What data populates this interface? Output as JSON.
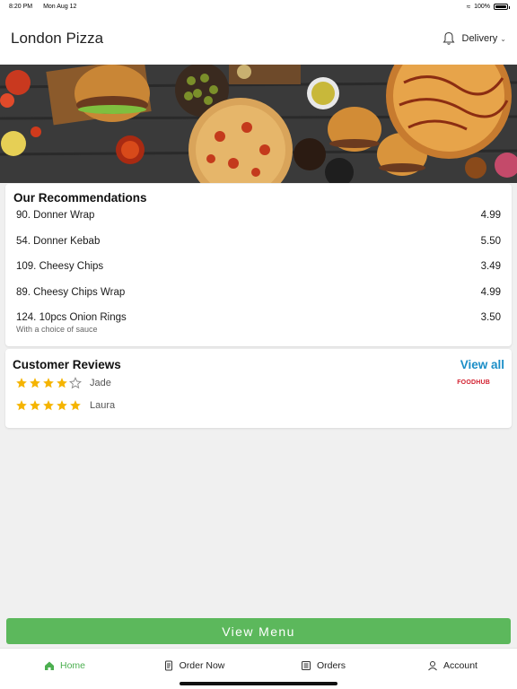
{
  "status_bar": {
    "time": "8:20 PM",
    "date": "Mon Aug 12",
    "battery": "100%"
  },
  "header": {
    "title": "London Pizza",
    "mode": "Delivery"
  },
  "recommendations": {
    "title": "Our Recommendations",
    "items": [
      {
        "name": "90. Donner Wrap",
        "price": "4.99",
        "sub": ""
      },
      {
        "name": "54. Donner Kebab",
        "price": "5.50",
        "sub": ""
      },
      {
        "name": "109. Cheesy Chips",
        "price": "3.49",
        "sub": ""
      },
      {
        "name": "89. Cheesy Chips Wrap",
        "price": "4.99",
        "sub": ""
      },
      {
        "name": "124. 10pcs Onion Rings",
        "price": "3.50",
        "sub": "With a choice of sauce"
      }
    ]
  },
  "reviews": {
    "title": "Customer Reviews",
    "view_all": "View all",
    "brand": "FOODHUB",
    "items": [
      {
        "name": "Jade",
        "rating": 4
      },
      {
        "name": "Laura",
        "rating": 5
      }
    ]
  },
  "view_menu_label": "View Menu",
  "tabs": [
    {
      "label": "Home",
      "icon": "home-icon",
      "active": true
    },
    {
      "label": "Order Now",
      "icon": "order-icon",
      "active": false
    },
    {
      "label": "Orders",
      "icon": "orders-icon",
      "active": false
    },
    {
      "label": "Account",
      "icon": "account-icon",
      "active": false
    }
  ],
  "colors": {
    "accent": "#5cb85c",
    "link": "#1b8ec7",
    "star": "#f5b400",
    "brand": "#d3202f"
  }
}
